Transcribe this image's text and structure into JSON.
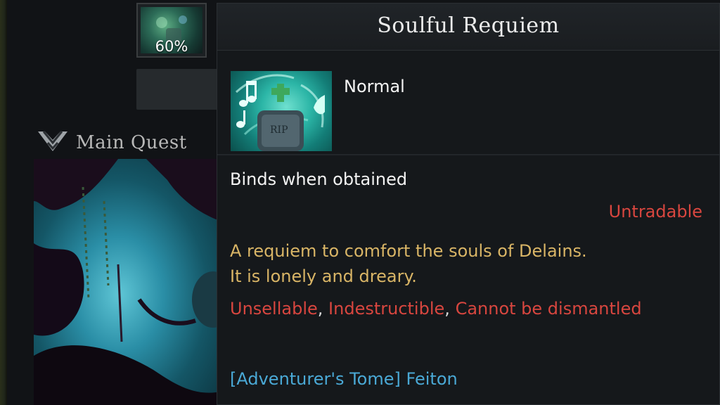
{
  "background": {
    "reward_slot": {
      "percent": "60%"
    },
    "quest_section": {
      "label": "Main Quest"
    }
  },
  "tooltip": {
    "title": "Soulful Requiem",
    "icon": "music-notes-gravestone-icon",
    "rarity": "Normal",
    "bind_status": "Binds when obtained",
    "trade_status": "Untradable",
    "description_line1": "A requiem to comfort the souls of Delains.",
    "description_line2": "It is lonely and dreary.",
    "restrictions": {
      "item1": "Unsellable",
      "item2": "Indestructible",
      "item3": "Cannot be dismantled",
      "separator": ","
    },
    "source": "[Adventurer's Tome] Feiton"
  },
  "colors": {
    "title": "#ececec",
    "rarity_normal": "#f4f4f4",
    "restriction_red": "#d8463f",
    "description_gold": "#d9b566",
    "source_blue": "#4aa9d6"
  }
}
